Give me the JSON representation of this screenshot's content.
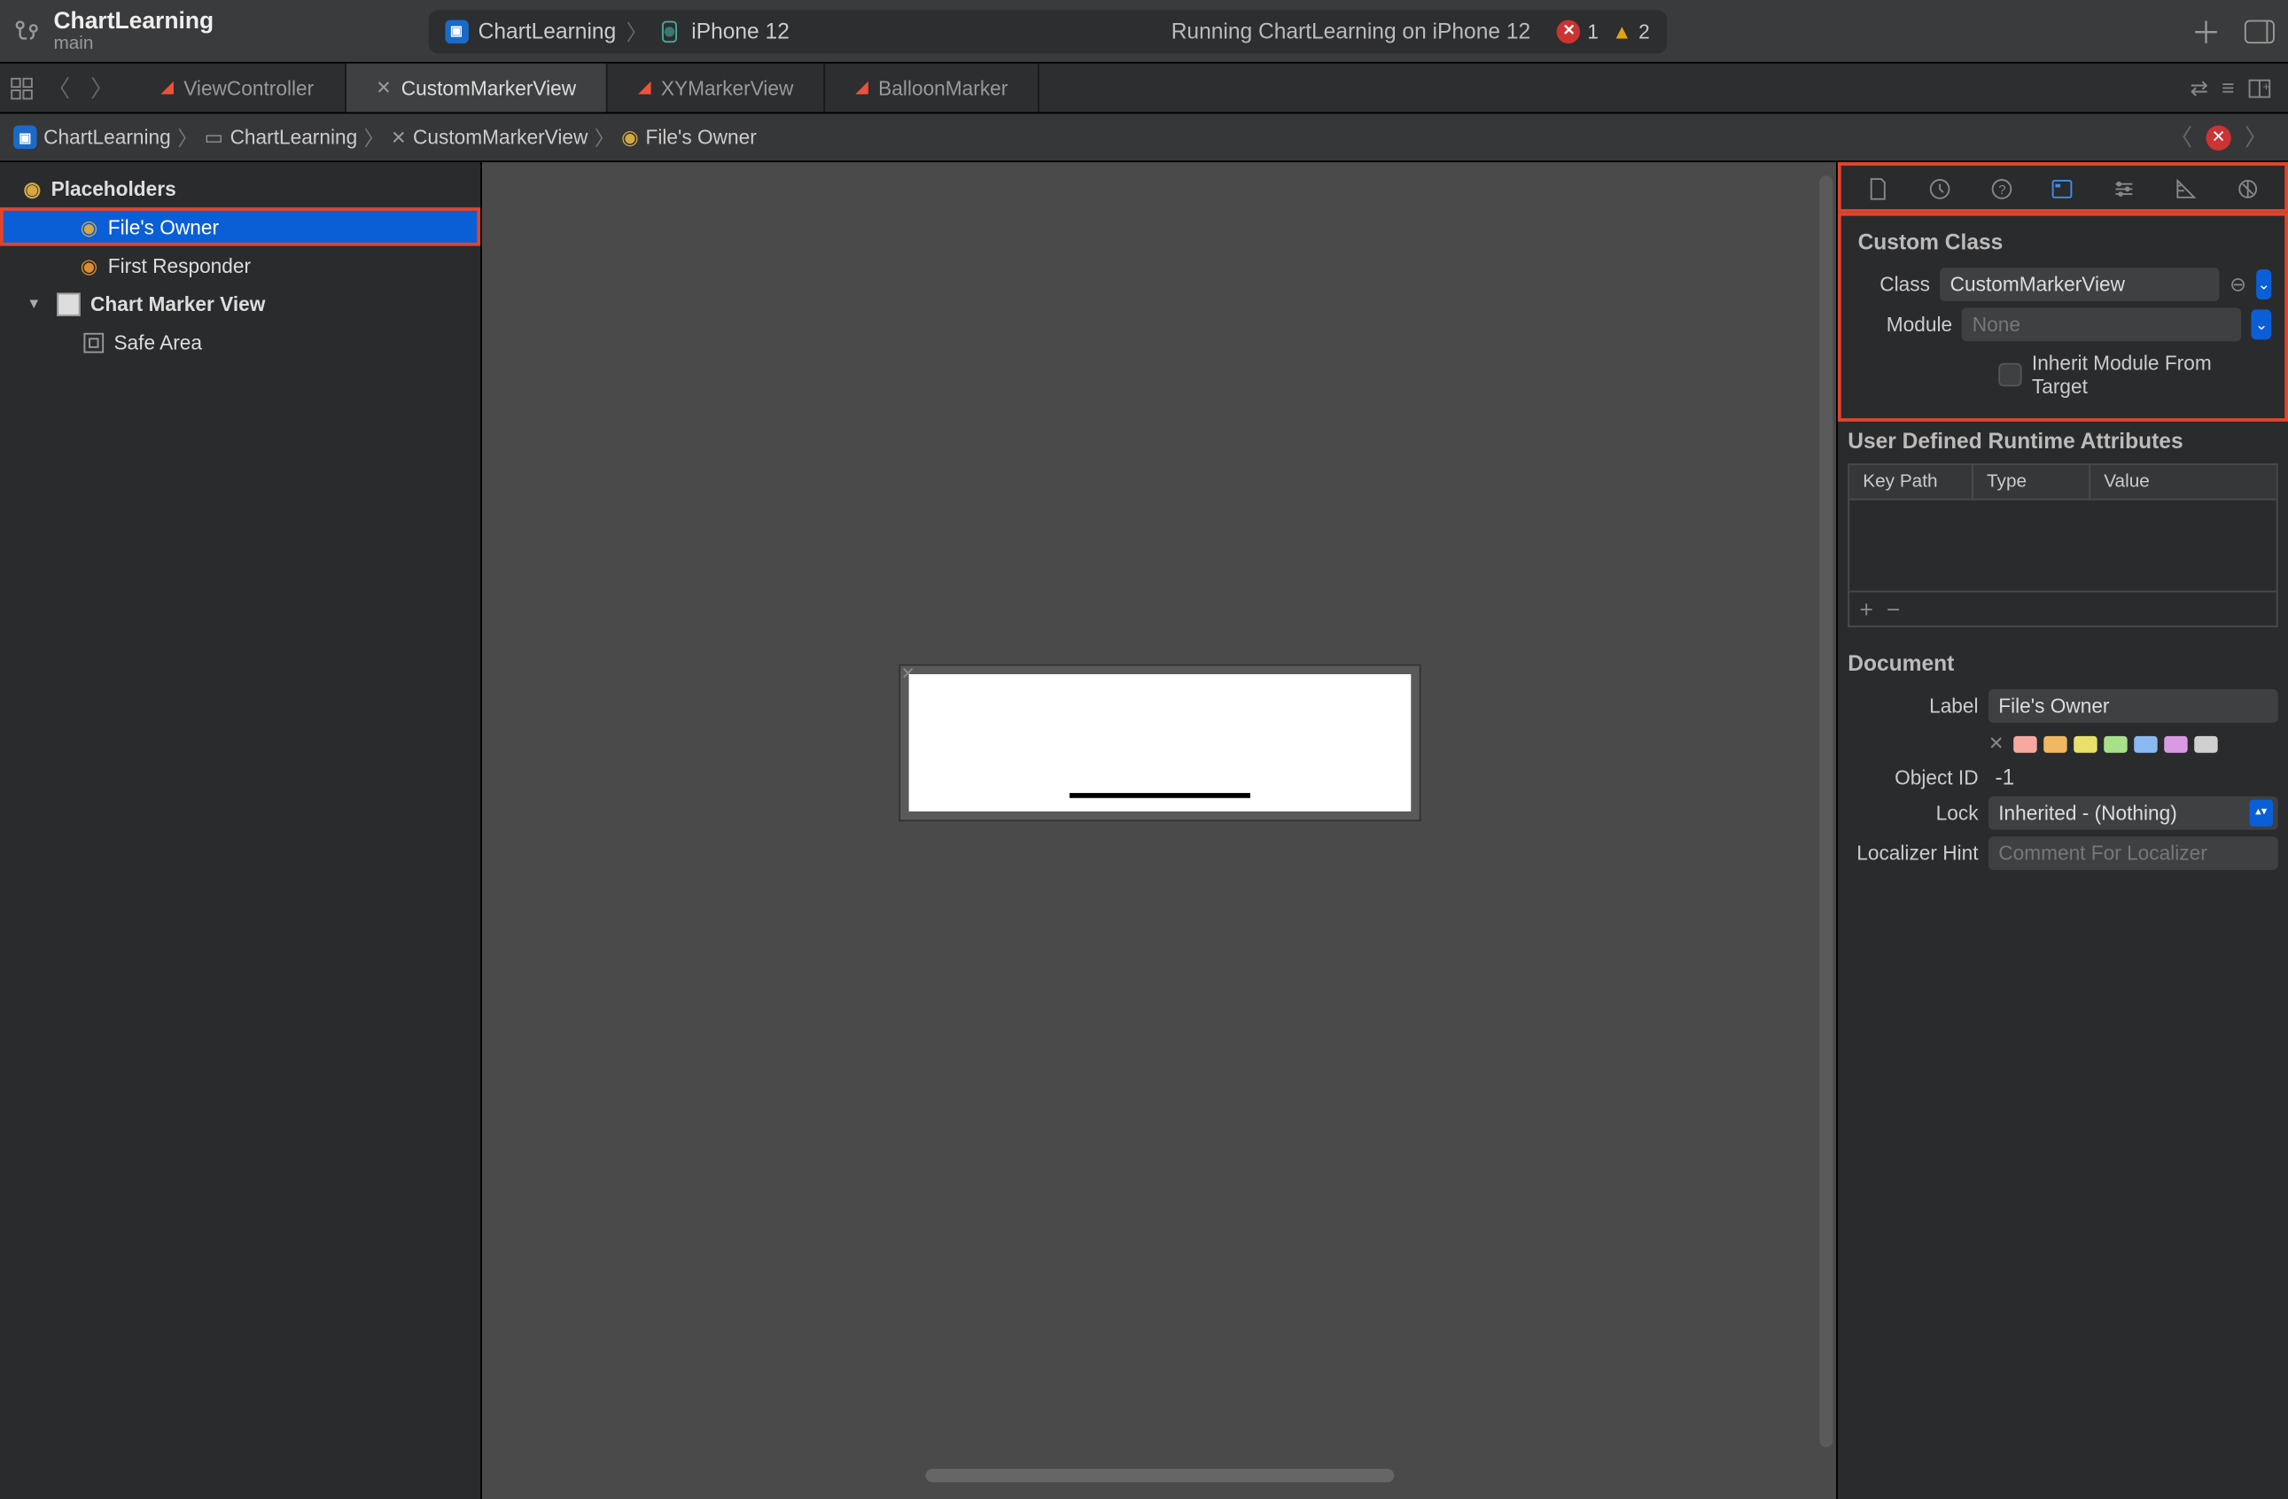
{
  "project": {
    "name": "ChartLearning",
    "branch": "main"
  },
  "scheme": {
    "app": "ChartLearning",
    "device": "iPhone 12"
  },
  "status": {
    "running": "Running ChartLearning on iPhone 12",
    "errors": "1",
    "warnings": "2"
  },
  "tabs": [
    {
      "label": "ViewController",
      "kind": "swift",
      "active": false
    },
    {
      "label": "CustomMarkerView",
      "kind": "xib",
      "active": true
    },
    {
      "label": "XYMarkerView",
      "kind": "swift",
      "active": false
    },
    {
      "label": "BalloonMarker",
      "kind": "swift",
      "active": false
    }
  ],
  "breadcrumb": {
    "items": [
      "ChartLearning",
      "ChartLearning",
      "CustomMarkerView",
      "File's Owner"
    ]
  },
  "outline": {
    "placeholders_label": "Placeholders",
    "files_owner": "File's Owner",
    "first_responder": "First Responder",
    "chart_marker_view": "Chart Marker View",
    "safe_area": "Safe Area"
  },
  "inspector": {
    "custom_class": {
      "title": "Custom Class",
      "class_label": "Class",
      "class_value": "CustomMarkerView",
      "module_label": "Module",
      "module_placeholder": "None",
      "inherit_label": "Inherit Module From Target"
    },
    "runtime_attrs": {
      "title": "User Defined Runtime Attributes",
      "cols": {
        "key": "Key Path",
        "type": "Type",
        "value": "Value"
      }
    },
    "document": {
      "title": "Document",
      "label_label": "Label",
      "label_value": "File's Owner",
      "object_id_label": "Object ID",
      "object_id_value": "-1",
      "lock_label": "Lock",
      "lock_value": "Inherited - (Nothing)",
      "localizer_label": "Localizer Hint",
      "localizer_placeholder": "Comment For Localizer"
    },
    "swatches": [
      "#f7a8a0",
      "#f0b860",
      "#e8e06a",
      "#a8e08a",
      "#8ab8f0",
      "#d89ae0",
      "#d0d0d0"
    ]
  }
}
